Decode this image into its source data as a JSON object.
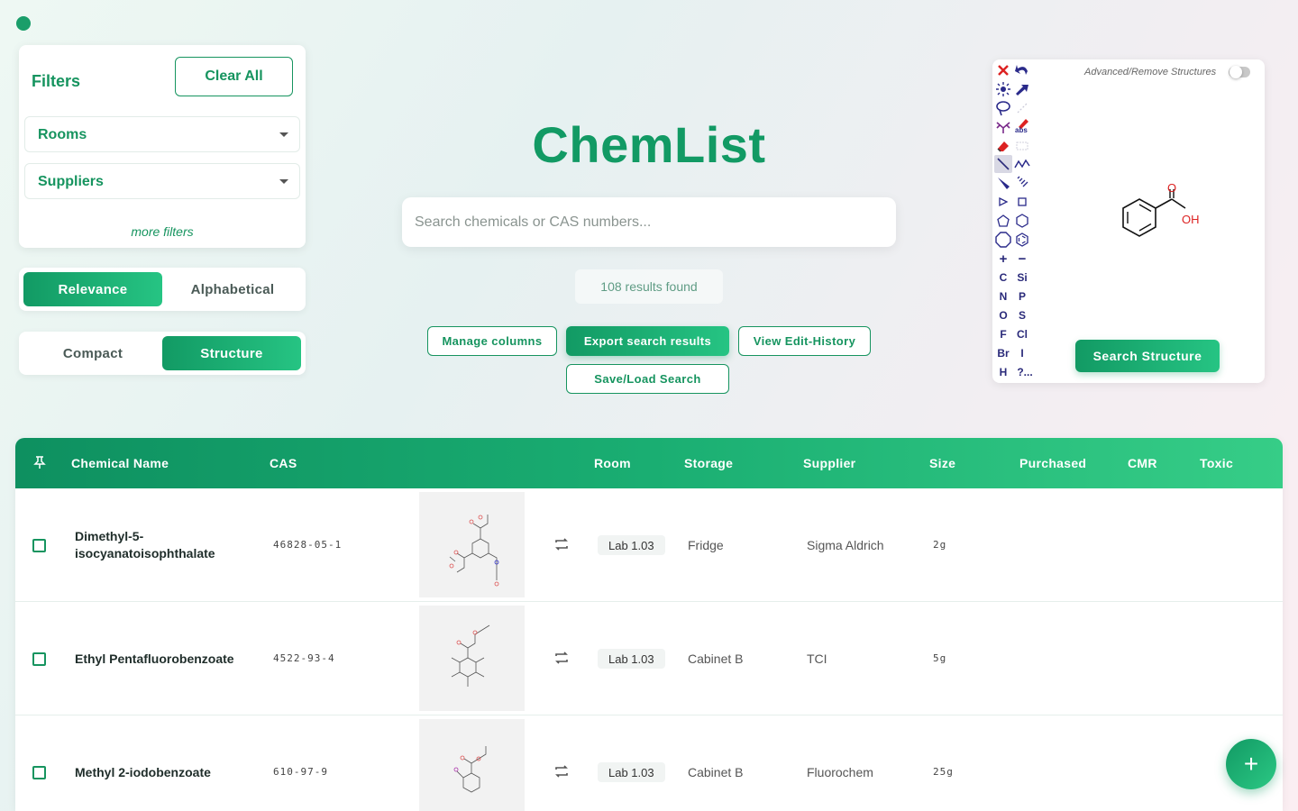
{
  "app": {
    "title": "ChemList"
  },
  "filters": {
    "title": "Filters",
    "clear_label": "Clear All",
    "rooms_label": "Rooms",
    "suppliers_label": "Suppliers",
    "more_label": "more filters"
  },
  "sort": {
    "options": [
      "Relevance",
      "Alphabetical"
    ],
    "active": "Relevance"
  },
  "view": {
    "options": [
      "Compact",
      "Structure"
    ],
    "active": "Structure"
  },
  "search": {
    "placeholder": "Search chemicals or CAS numbers...",
    "value": ""
  },
  "results": {
    "text": "108 results found"
  },
  "actions": {
    "manage_columns": "Manage columns",
    "export": "Export search results",
    "history": "View Edit-History",
    "save_load": "Save/Load Search"
  },
  "editor": {
    "advanced_label": "Advanced/Remove Structures",
    "search_label": "Search Structure",
    "elements": [
      "C",
      "Si",
      "N",
      "P",
      "O",
      "S",
      "F",
      "Cl",
      "Br",
      "I",
      "H",
      "?..."
    ],
    "molecule_labels": {
      "o": "O",
      "oh": "OH"
    },
    "misc_labels": {
      "abs": "abs"
    }
  },
  "table": {
    "headers": [
      "Chemical Name",
      "CAS",
      "Room",
      "Storage",
      "Supplier",
      "Size",
      "Purchased",
      "CMR",
      "Toxic"
    ],
    "rows": [
      {
        "name": "Dimethyl-5-isocyanatoisophthalate",
        "cas": "46828-05-1",
        "room": "Lab 1.03",
        "storage": "Fridge",
        "supplier": "Sigma Aldrich",
        "size": "2g"
      },
      {
        "name": "Ethyl Pentafluorobenzoate",
        "cas": "4522-93-4",
        "room": "Lab 1.03",
        "storage": "Cabinet B",
        "supplier": "TCI",
        "size": "5g"
      },
      {
        "name": "Methyl 2-iodobenzoate",
        "cas": "610-97-9",
        "room": "Lab 1.03",
        "storage": "Cabinet B",
        "supplier": "Fluorochem",
        "size": "25g"
      }
    ]
  },
  "colors": {
    "primary": "#16945f",
    "accent": "#26c483"
  },
  "icons": {
    "status": "status-dot-icon",
    "pin": "pin-icon",
    "swap": "swap-icon",
    "add": "plus-icon",
    "dropdown": "chevron-down-icon"
  }
}
